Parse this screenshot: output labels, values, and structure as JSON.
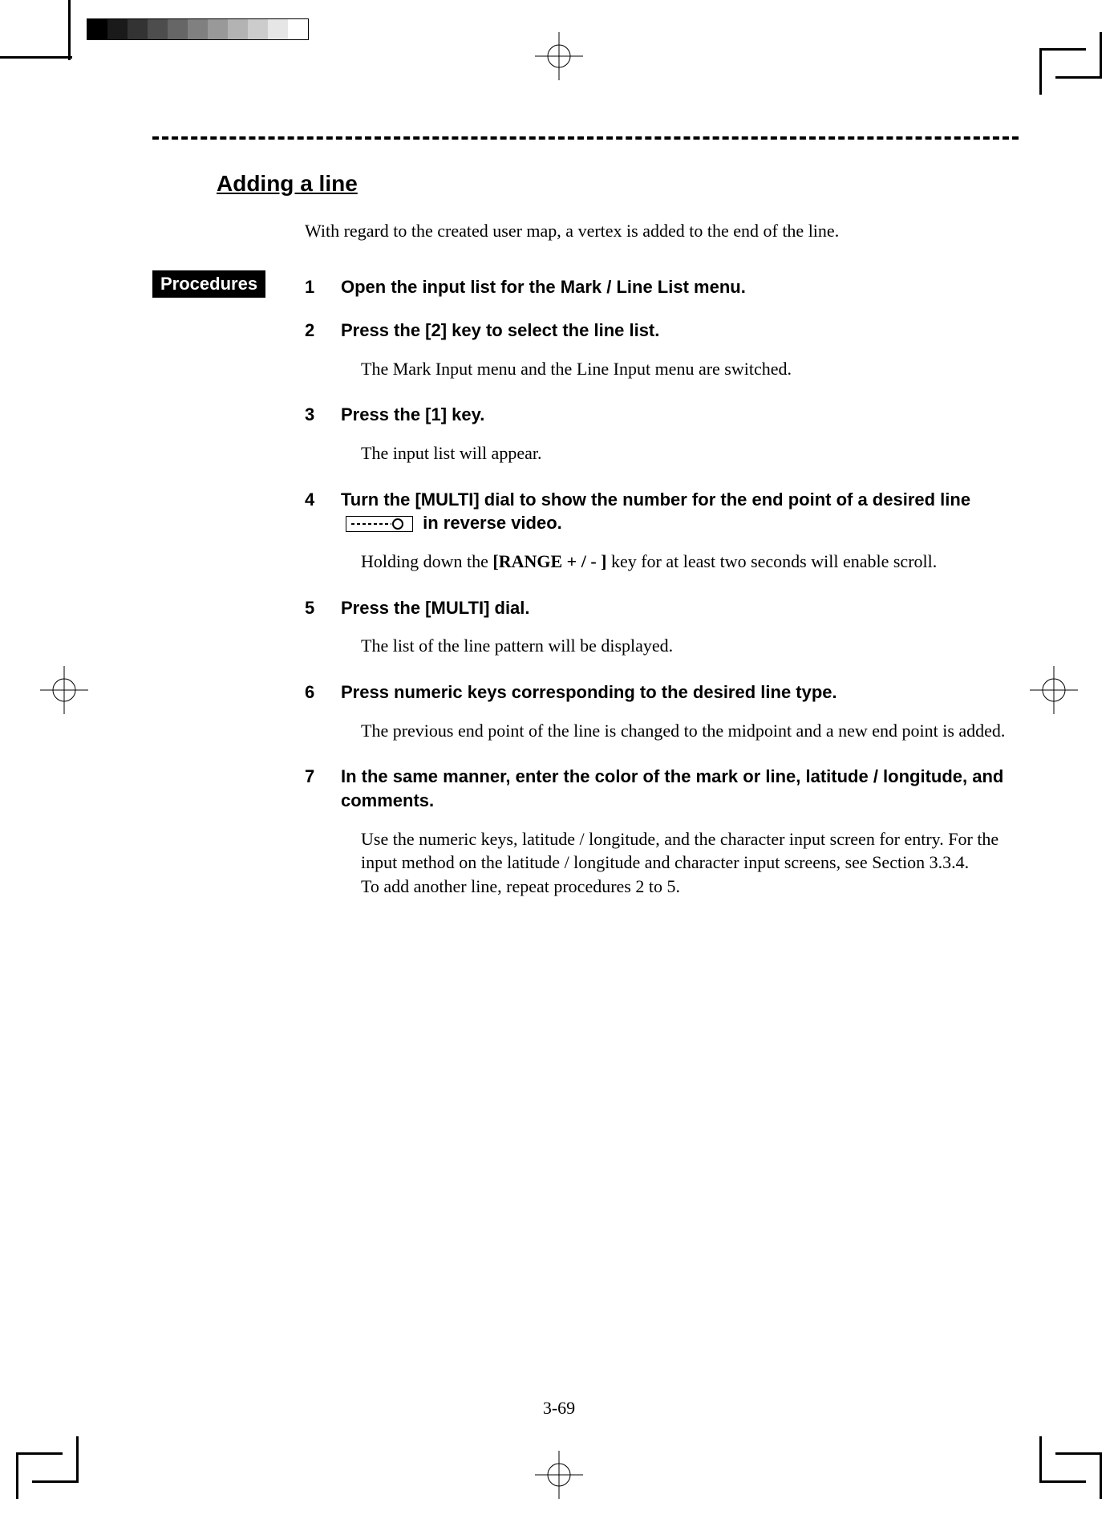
{
  "section_title": "Adding a line",
  "intro": "With regard to the created user map, a vertex is added to the end of the line.",
  "procedures_label": "Procedures",
  "steps": [
    {
      "num": "1",
      "title": "Open the input list for the Mark / Line List menu."
    },
    {
      "num": "2",
      "title": "Press the [2] key to select the line list.",
      "note": "The Mark Input menu and the Line Input menu are switched."
    },
    {
      "num": "3",
      "title": "Press the [1] key.",
      "note": "The input list will appear."
    },
    {
      "num": "4",
      "title_pre": "Turn the [MULTI] dial to show the number for the end point of a desired line ",
      "title_post": " in reverse video.",
      "note_pre": "Holding down the ",
      "range_key": "[RANGE + / - ]",
      "note_post": " key for at least two seconds will enable scroll."
    },
    {
      "num": "5",
      "title": "Press the [MULTI] dial.",
      "note": "The list of the line pattern will be displayed."
    },
    {
      "num": "6",
      "title": "Press numeric keys corresponding to the desired line type.",
      "note": "The previous end point of the line is changed to the midpoint and a new end point is added."
    },
    {
      "num": "7",
      "title": "In the same manner, enter the color of the mark or line, latitude / longitude, and comments.",
      "note": "Use the numeric keys, latitude / longitude, and the character input screen for entry. For the input method on the latitude / longitude and character input screens, see Section 3.3.4.\nTo add another line, repeat procedures 2 to 5."
    }
  ],
  "page_number": "3-69"
}
